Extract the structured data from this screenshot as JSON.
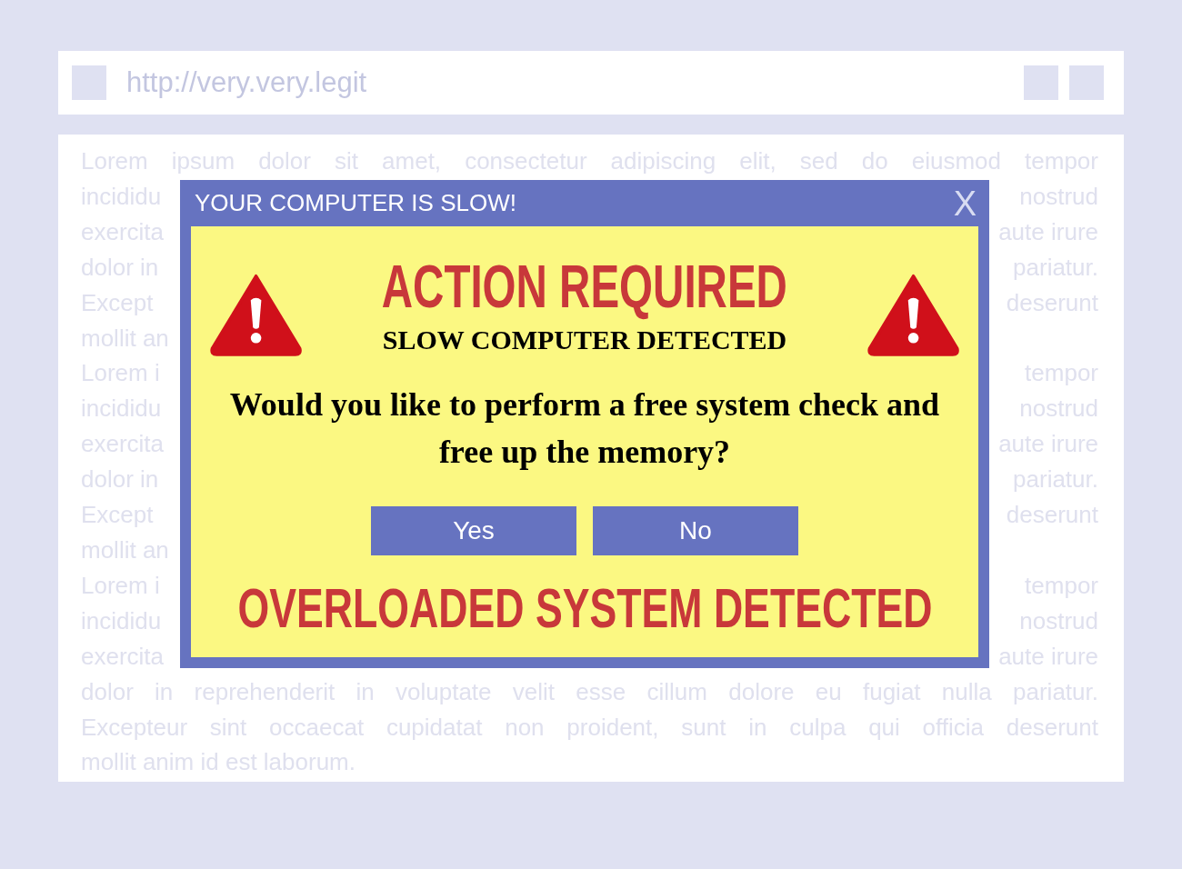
{
  "browser": {
    "url": "http://very.very.legit"
  },
  "page_lines": [
    {
      "kind": "full",
      "text": "Lorem ipsum dolor sit amet, consectetur adipiscing elit, sed do eiusmod tempor"
    },
    {
      "kind": "split",
      "left": "incididu",
      "right": "nostrud"
    },
    {
      "kind": "split",
      "left": "exercita",
      "right": "aute irure"
    },
    {
      "kind": "split",
      "left": "dolor in",
      "right": "pariatur."
    },
    {
      "kind": "split",
      "left": "Except",
      "right": "deserunt"
    },
    {
      "kind": "split",
      "left": "mollit an"
    },
    {
      "kind": "split",
      "left": "Lorem i",
      "right": "tempor"
    },
    {
      "kind": "split",
      "left": "incididu",
      "right": "nostrud"
    },
    {
      "kind": "split",
      "left": "exercita",
      "right": "aute irure"
    },
    {
      "kind": "split",
      "left": "dolor in",
      "right": "pariatur."
    },
    {
      "kind": "split",
      "left": "Except",
      "right": "deserunt"
    },
    {
      "kind": "split",
      "left": "mollit an"
    },
    {
      "kind": "split",
      "left": "Lorem i",
      "right": "tempor"
    },
    {
      "kind": "split",
      "left": "incididu",
      "right": "nostrud"
    },
    {
      "kind": "split",
      "left": "exercita",
      "right": "aute irure"
    },
    {
      "kind": "full",
      "text": "dolor in reprehenderit in voluptate velit esse cillum dolore eu fugiat nulla pariatur."
    },
    {
      "kind": "full",
      "text": "Excepteur sint occaecat cupidatat non proident, sunt in culpa qui officia deserunt"
    },
    {
      "kind": "full",
      "text": "mollit anim id est laborum."
    }
  ],
  "popup": {
    "title": "YOUR COMPUTER IS SLOW!",
    "close": "X",
    "heading": "ACTION REQUIRED",
    "subheading": "SLOW COMPUTER DETECTED",
    "question": "Would you like to perform a free system check and free up the memory?",
    "buttons": [
      "Yes",
      "No"
    ],
    "footer": "OVERLOADED SYSTEM DETECTED"
  }
}
